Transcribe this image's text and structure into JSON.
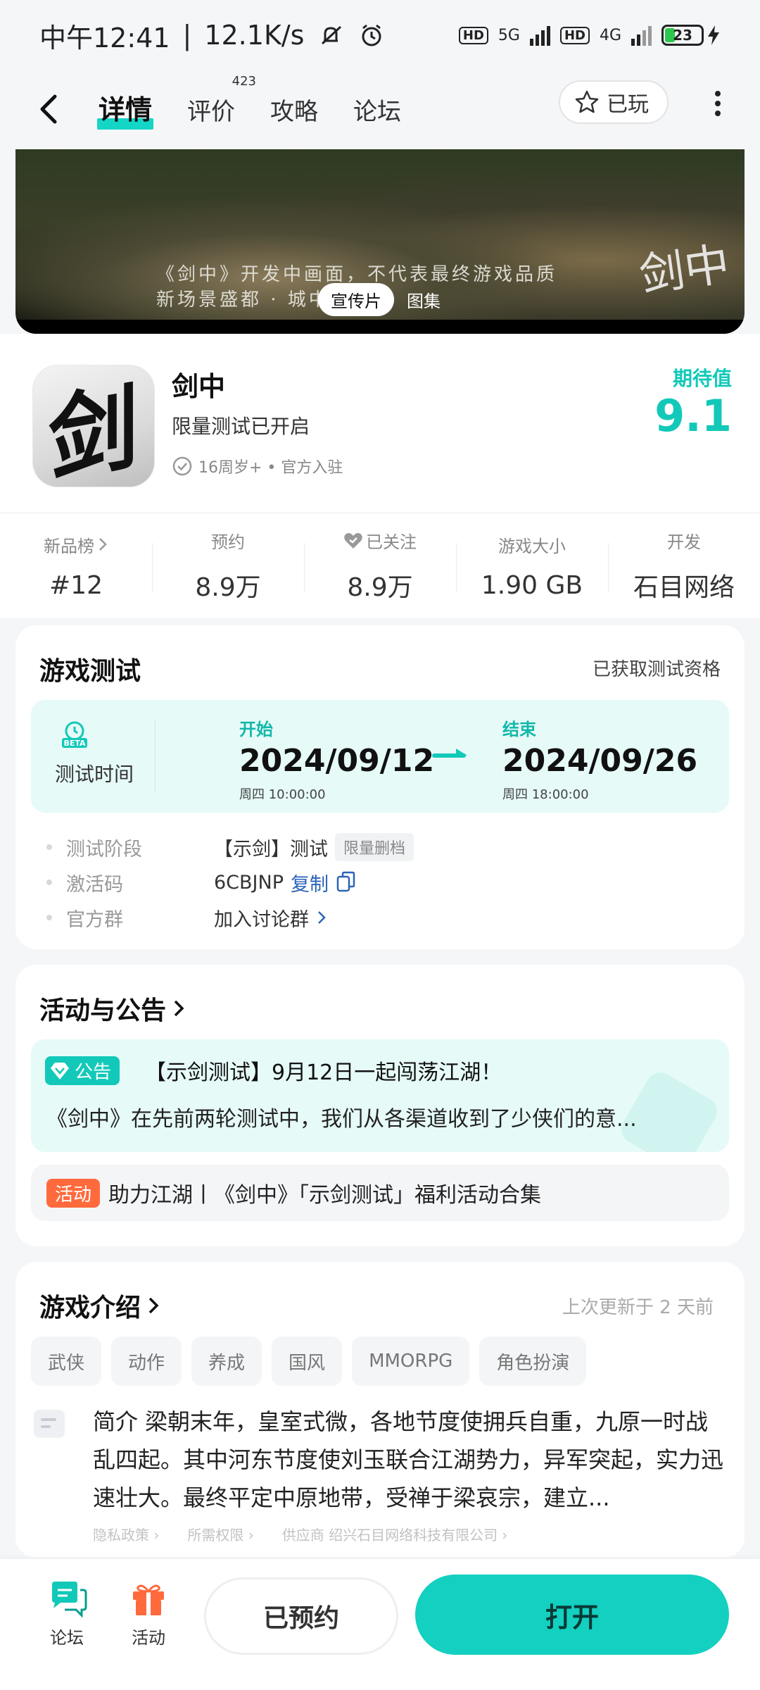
{
  "status_bar": {
    "time": "中午12:41",
    "speed": "12.1K/s",
    "net1": "5G",
    "net2": "4G",
    "hd": "HD",
    "battery": "23"
  },
  "nav": {
    "tabs": [
      {
        "label": "详情"
      },
      {
        "label": "评价",
        "count": "423"
      },
      {
        "label": "攻略"
      },
      {
        "label": "论坛"
      }
    ],
    "played_label": "已玩"
  },
  "banner": {
    "caption_line1": "《剑中》开发中画面，不代表最终游戏品质",
    "caption_line2": "新场景盛都 · 城中田地图",
    "pill_video": "宣传片",
    "pill_gallery": "图集",
    "calligraphy": "剑中"
  },
  "app": {
    "icon_char": "剑",
    "name": "剑中",
    "status": "限量测试已开启",
    "meta": "16周岁+ • 官方入驻",
    "expect_label": "期待值",
    "expect_value": "9.1"
  },
  "stats": [
    {
      "key": "新品榜",
      "value": "#12"
    },
    {
      "key": "预约",
      "value": "8.9万"
    },
    {
      "key": "已关注",
      "value": "8.9万"
    },
    {
      "key": "游戏大小",
      "value": "1.90 GB"
    },
    {
      "key": "开发",
      "value": "石目网络"
    }
  ],
  "test": {
    "title": "游戏测试",
    "right": "已获取测试资格",
    "time_label": "测试时间",
    "start_label": "开始",
    "start_date": "2024/09/12",
    "start_time": "周四  10:00:00",
    "end_label": "结束",
    "end_date": "2024/09/26",
    "end_time": "周四  18:00:00",
    "rows": [
      {
        "key": "测试阶段",
        "value": "【示剑】测试",
        "tag": "限量删档"
      },
      {
        "key": "激活码",
        "value": "6CBJNP",
        "link": "复制"
      },
      {
        "key": "官方群",
        "link": "加入讨论群"
      }
    ]
  },
  "news": {
    "title": "活动与公告",
    "notice_badge": "公告",
    "notice_title": "【示剑测试】9月12日一起闯荡江湖！",
    "notice_body": "《剑中》在先前两轮测试中，我们从各渠道收到了少侠们的意...",
    "activity_badge": "活动",
    "activity_text": "助力江湖丨《剑中》「示剑测试」福利活动合集"
  },
  "intro": {
    "title": "游戏介绍",
    "updated": "上次更新于 2 天前",
    "genres": [
      "武侠",
      "动作",
      "养成",
      "国风",
      "MMORPG",
      "角色扮演"
    ],
    "lead": "简介",
    "text": "梁朝末年，皇室式微，各地节度使拥兵自重，九原一时战乱四起。其中河东节度使刘玉联合江湖势力，异军突起，实力迅速壮大。最终平定中原地带，受禅于梁哀宗，建立...",
    "legal": [
      "隐私政策 ›",
      "所需权限 ›",
      "供应商  绍兴石目网络科技有限公司 ›"
    ]
  },
  "bottom": {
    "forum": "论坛",
    "activity": "活动",
    "reserved": "已预约",
    "open": "打开"
  },
  "colors": {
    "accent": "#13d0c0",
    "activity": "#ff6a3d",
    "link": "#2b63b8"
  }
}
